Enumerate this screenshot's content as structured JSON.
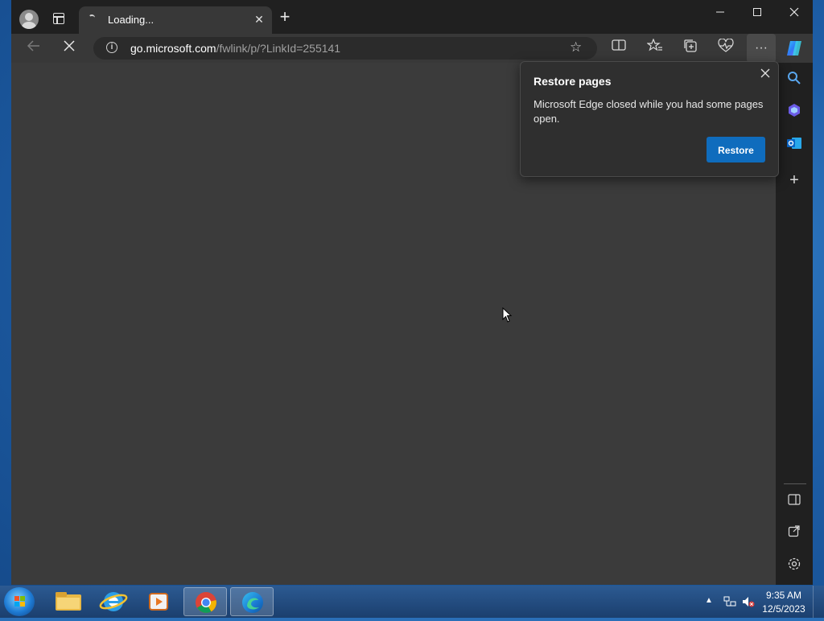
{
  "tab": {
    "title": "Loading...",
    "close_glyph": "✕"
  },
  "toolbar": {
    "url_domain": "go.microsoft.com",
    "url_path": "/fwlink/p/?LinkId=255141"
  },
  "restore_popup": {
    "title": "Restore pages",
    "message": "Microsoft Edge closed while you had some pages open.",
    "button_label": "Restore"
  },
  "taskbar": {
    "time": "9:35 AM",
    "date": "12/5/2023",
    "apps": [
      "windows-explorer",
      "internet-explorer",
      "windows-media-player",
      "google-chrome",
      "microsoft-edge"
    ]
  },
  "colors": {
    "accent": "#0f6cbd",
    "content_bg": "#3b3b3b",
    "chrome_bg": "#202020"
  },
  "icons": {
    "sidebar": [
      "search-icon",
      "copilot-icon",
      "outlook-icon",
      "add-icon",
      "sidebar-toggle-icon",
      "external-link-icon",
      "settings-icon"
    ],
    "toolbar": [
      "back-icon",
      "stop-icon",
      "info-icon",
      "favorite-star-icon",
      "split-screen-icon",
      "favorites-icon",
      "collections-icon",
      "heart-pulse-icon",
      "more-icon",
      "copilot-icon"
    ]
  }
}
